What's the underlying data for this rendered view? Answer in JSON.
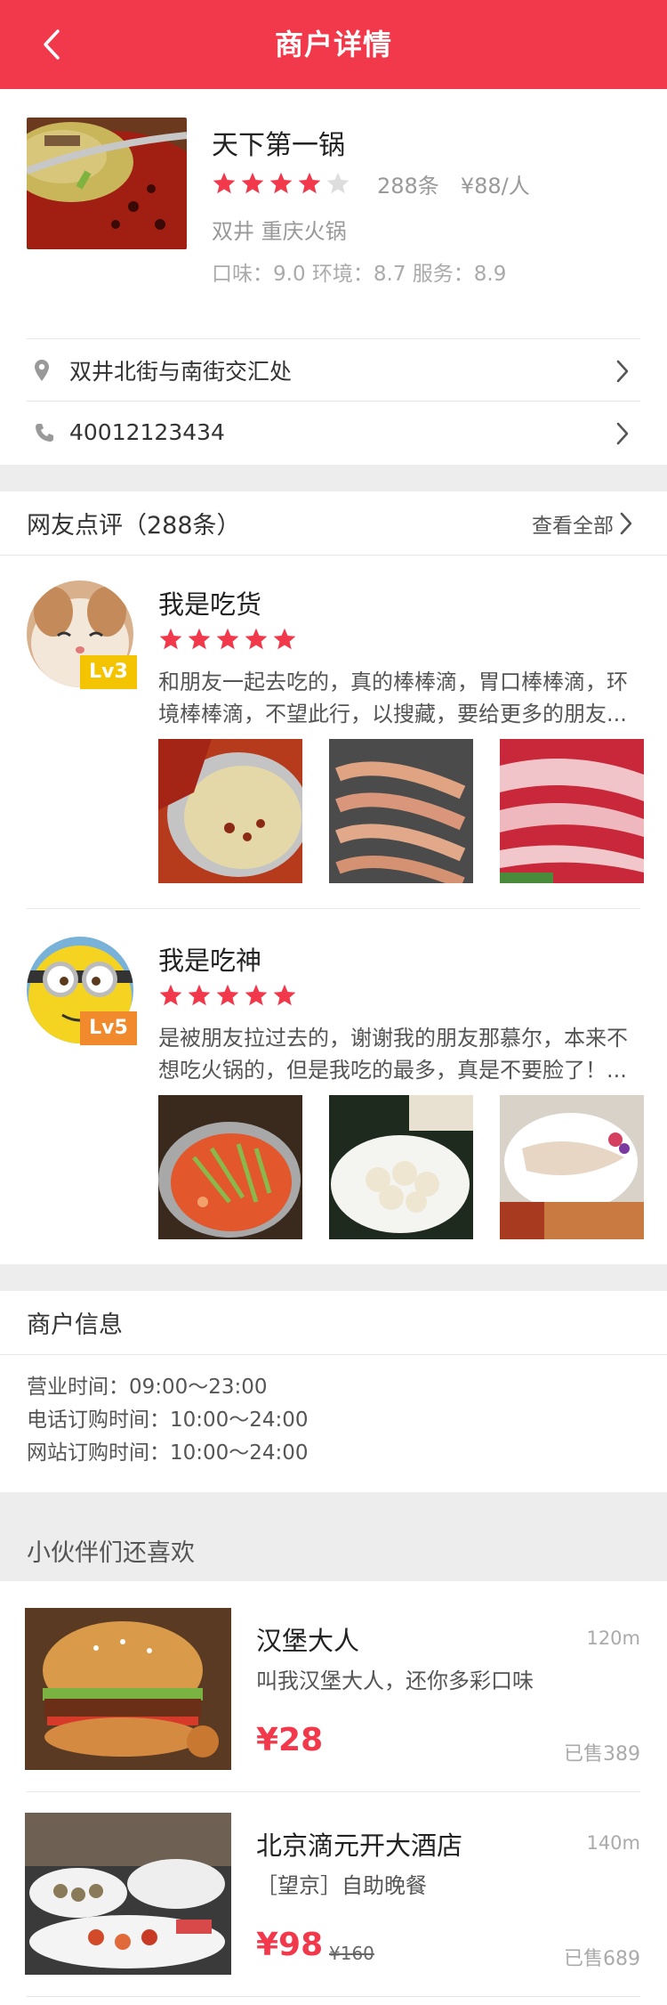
{
  "header": {
    "title": "商户详情"
  },
  "shop": {
    "name": "天下第一锅",
    "rating": 4,
    "rating_max": 5,
    "review_count": "288条",
    "price": "¥88/人",
    "category": "双井 重庆火锅",
    "scores": "口味：9.0  环境：8.7  服务：8.9",
    "address": "双井北街与南街交汇处",
    "phone": "40012123434"
  },
  "reviews_section": {
    "title": "网友点评（288条）",
    "more_label": "查看全部",
    "items": [
      {
        "user": "我是吃货",
        "level": "Lv3",
        "level_color": "#f5c400",
        "stars": 5,
        "text": "和朋友一起去吃的，真的棒棒滴，胃口棒棒滴，环境棒棒滴，不望此行，以搜藏，要给更多的朋友..."
      },
      {
        "user": "我是吃神",
        "level": "Lv5",
        "level_color": "#f08a2c",
        "stars": 5,
        "text": "是被朋友拉过去的，谢谢我的朋友那慕尔，本来不想吃火锅的，但是我吃的最多，真是不要脸了！..."
      }
    ]
  },
  "merchant_info": {
    "title": "商户信息",
    "hours": "营业时间：09:00～23:00",
    "phone_hours": "电话订购时间：10:00～24:00",
    "web_hours": "网站订购时间：10:00～24:00"
  },
  "recommend": {
    "title": "小伙伴们还喜欢",
    "items": [
      {
        "name": "汉堡大人",
        "distance": "120m",
        "desc": "叫我汉堡大人，还你多彩口味",
        "price": "¥28",
        "original_price": "",
        "sold": "已售389"
      },
      {
        "name": "北京滴元开大酒店",
        "distance": "140m",
        "desc": "［望京］自助晚餐",
        "price": "¥98",
        "original_price": "¥160",
        "sold": "已售689"
      }
    ]
  },
  "colors": {
    "accent": "#f2394b",
    "star_off": "#dddddd",
    "divider": "#ededed"
  }
}
